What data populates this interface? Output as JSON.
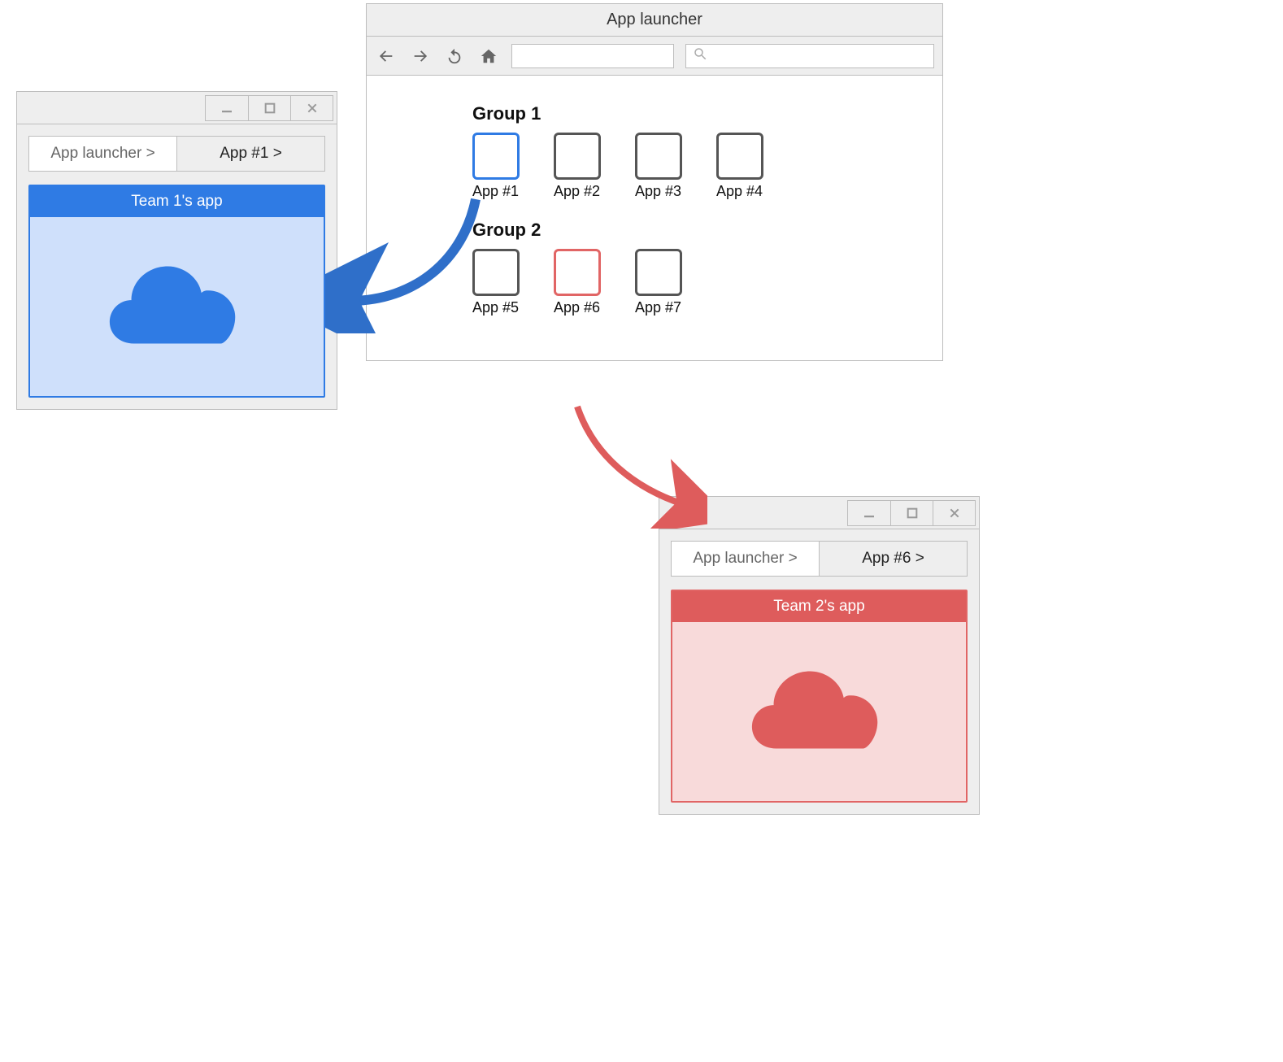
{
  "browser": {
    "title": "App launcher",
    "groups": [
      {
        "title": "Group 1",
        "apps": [
          {
            "label": "App #1",
            "highlight": "blue"
          },
          {
            "label": "App #2",
            "highlight": "none"
          },
          {
            "label": "App #3",
            "highlight": "none"
          },
          {
            "label": "App #4",
            "highlight": "none"
          }
        ]
      },
      {
        "title": "Group 2",
        "apps": [
          {
            "label": "App #5",
            "highlight": "none"
          },
          {
            "label": "App #6",
            "highlight": "red"
          },
          {
            "label": "App #7",
            "highlight": "none"
          }
        ]
      }
    ]
  },
  "window_blue": {
    "breadcrumb_root": "App launcher >",
    "breadcrumb_current": "App #1 >",
    "card_title": "Team 1's app",
    "accent": "#2f7be4"
  },
  "window_red": {
    "breadcrumb_root": "App launcher >",
    "breadcrumb_current": "App #6 >",
    "card_title": "Team 2's app",
    "accent": "#de5c5c"
  },
  "icons": {
    "minimize": "minimize-icon",
    "maximize": "maximize-icon",
    "close": "close-icon",
    "back": "back-icon",
    "forward": "forward-icon",
    "reload": "reload-icon",
    "home": "home-icon",
    "search": "search-icon",
    "cloud": "cloud-icon"
  }
}
